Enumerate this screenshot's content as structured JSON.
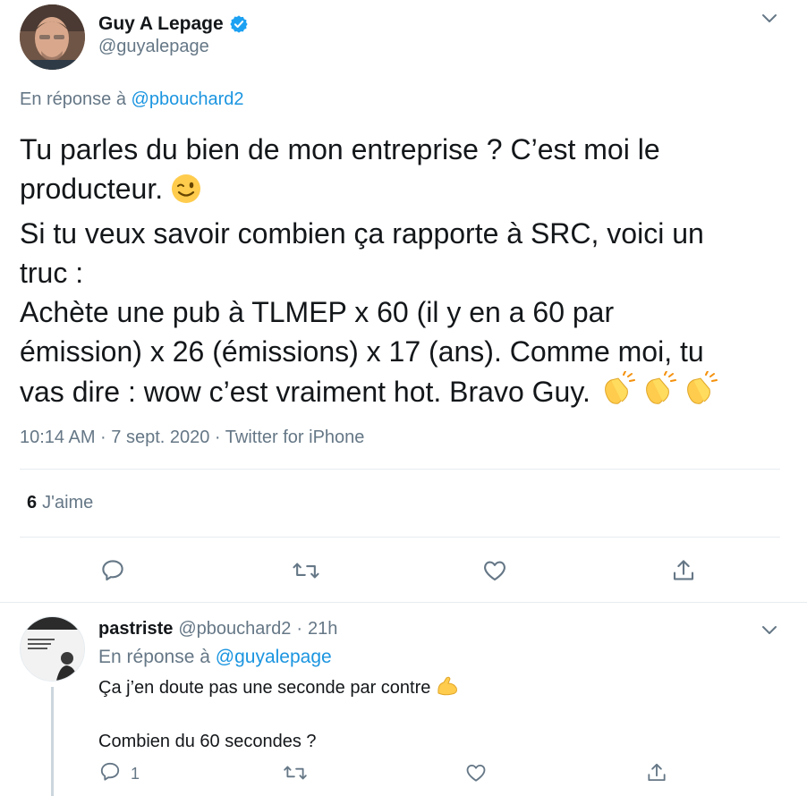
{
  "tweet": {
    "author_name": "Guy A Lepage",
    "handle": "@guyalepage",
    "reply_prefix": "En réponse à",
    "reply_target": "@pbouchard2",
    "lines": [
      "Tu parles du bien de mon entreprise ? C’est moi le",
      "producteur.",
      "Si tu veux savoir combien ça rapporte à SRC, voici un",
      "truc :",
      "Achète une pub à TLMEP x 60 (il y en a 60 par",
      "émission) x 26 (émissions) x 17 (ans). Comme moi, tu",
      "vas dire : wow c’est vraiment hot. Bravo Guy."
    ],
    "emoji_wink": "😉",
    "emoji_clap": "👏👏👏",
    "meta": "10:14 AM · 7 sept. 2020 · Twitter for iPhone",
    "likes_count": "6",
    "likes_label": "J'aime"
  },
  "reply": {
    "author_name": "pastriste",
    "handle": "@pbouchard2",
    "dot": "·",
    "time": "21h",
    "reply_prefix": "En réponse à",
    "reply_target": "@guyalepage",
    "line1": "Ça j’en doute pas une seconde par contre",
    "emoji_muscle": "💪",
    "line2": "Combien du 60 secondes ?",
    "reply_count": "1"
  },
  "icons": {
    "verified": "verified-badge-icon",
    "caret": "chevron-down-icon",
    "reply": "reply-icon",
    "retweet": "retweet-icon",
    "like": "heart-icon",
    "share": "share-icon"
  },
  "colors": {
    "link": "#1b95e0",
    "muted": "#657786",
    "text": "#14171a",
    "divider": "#e6ecf0"
  }
}
